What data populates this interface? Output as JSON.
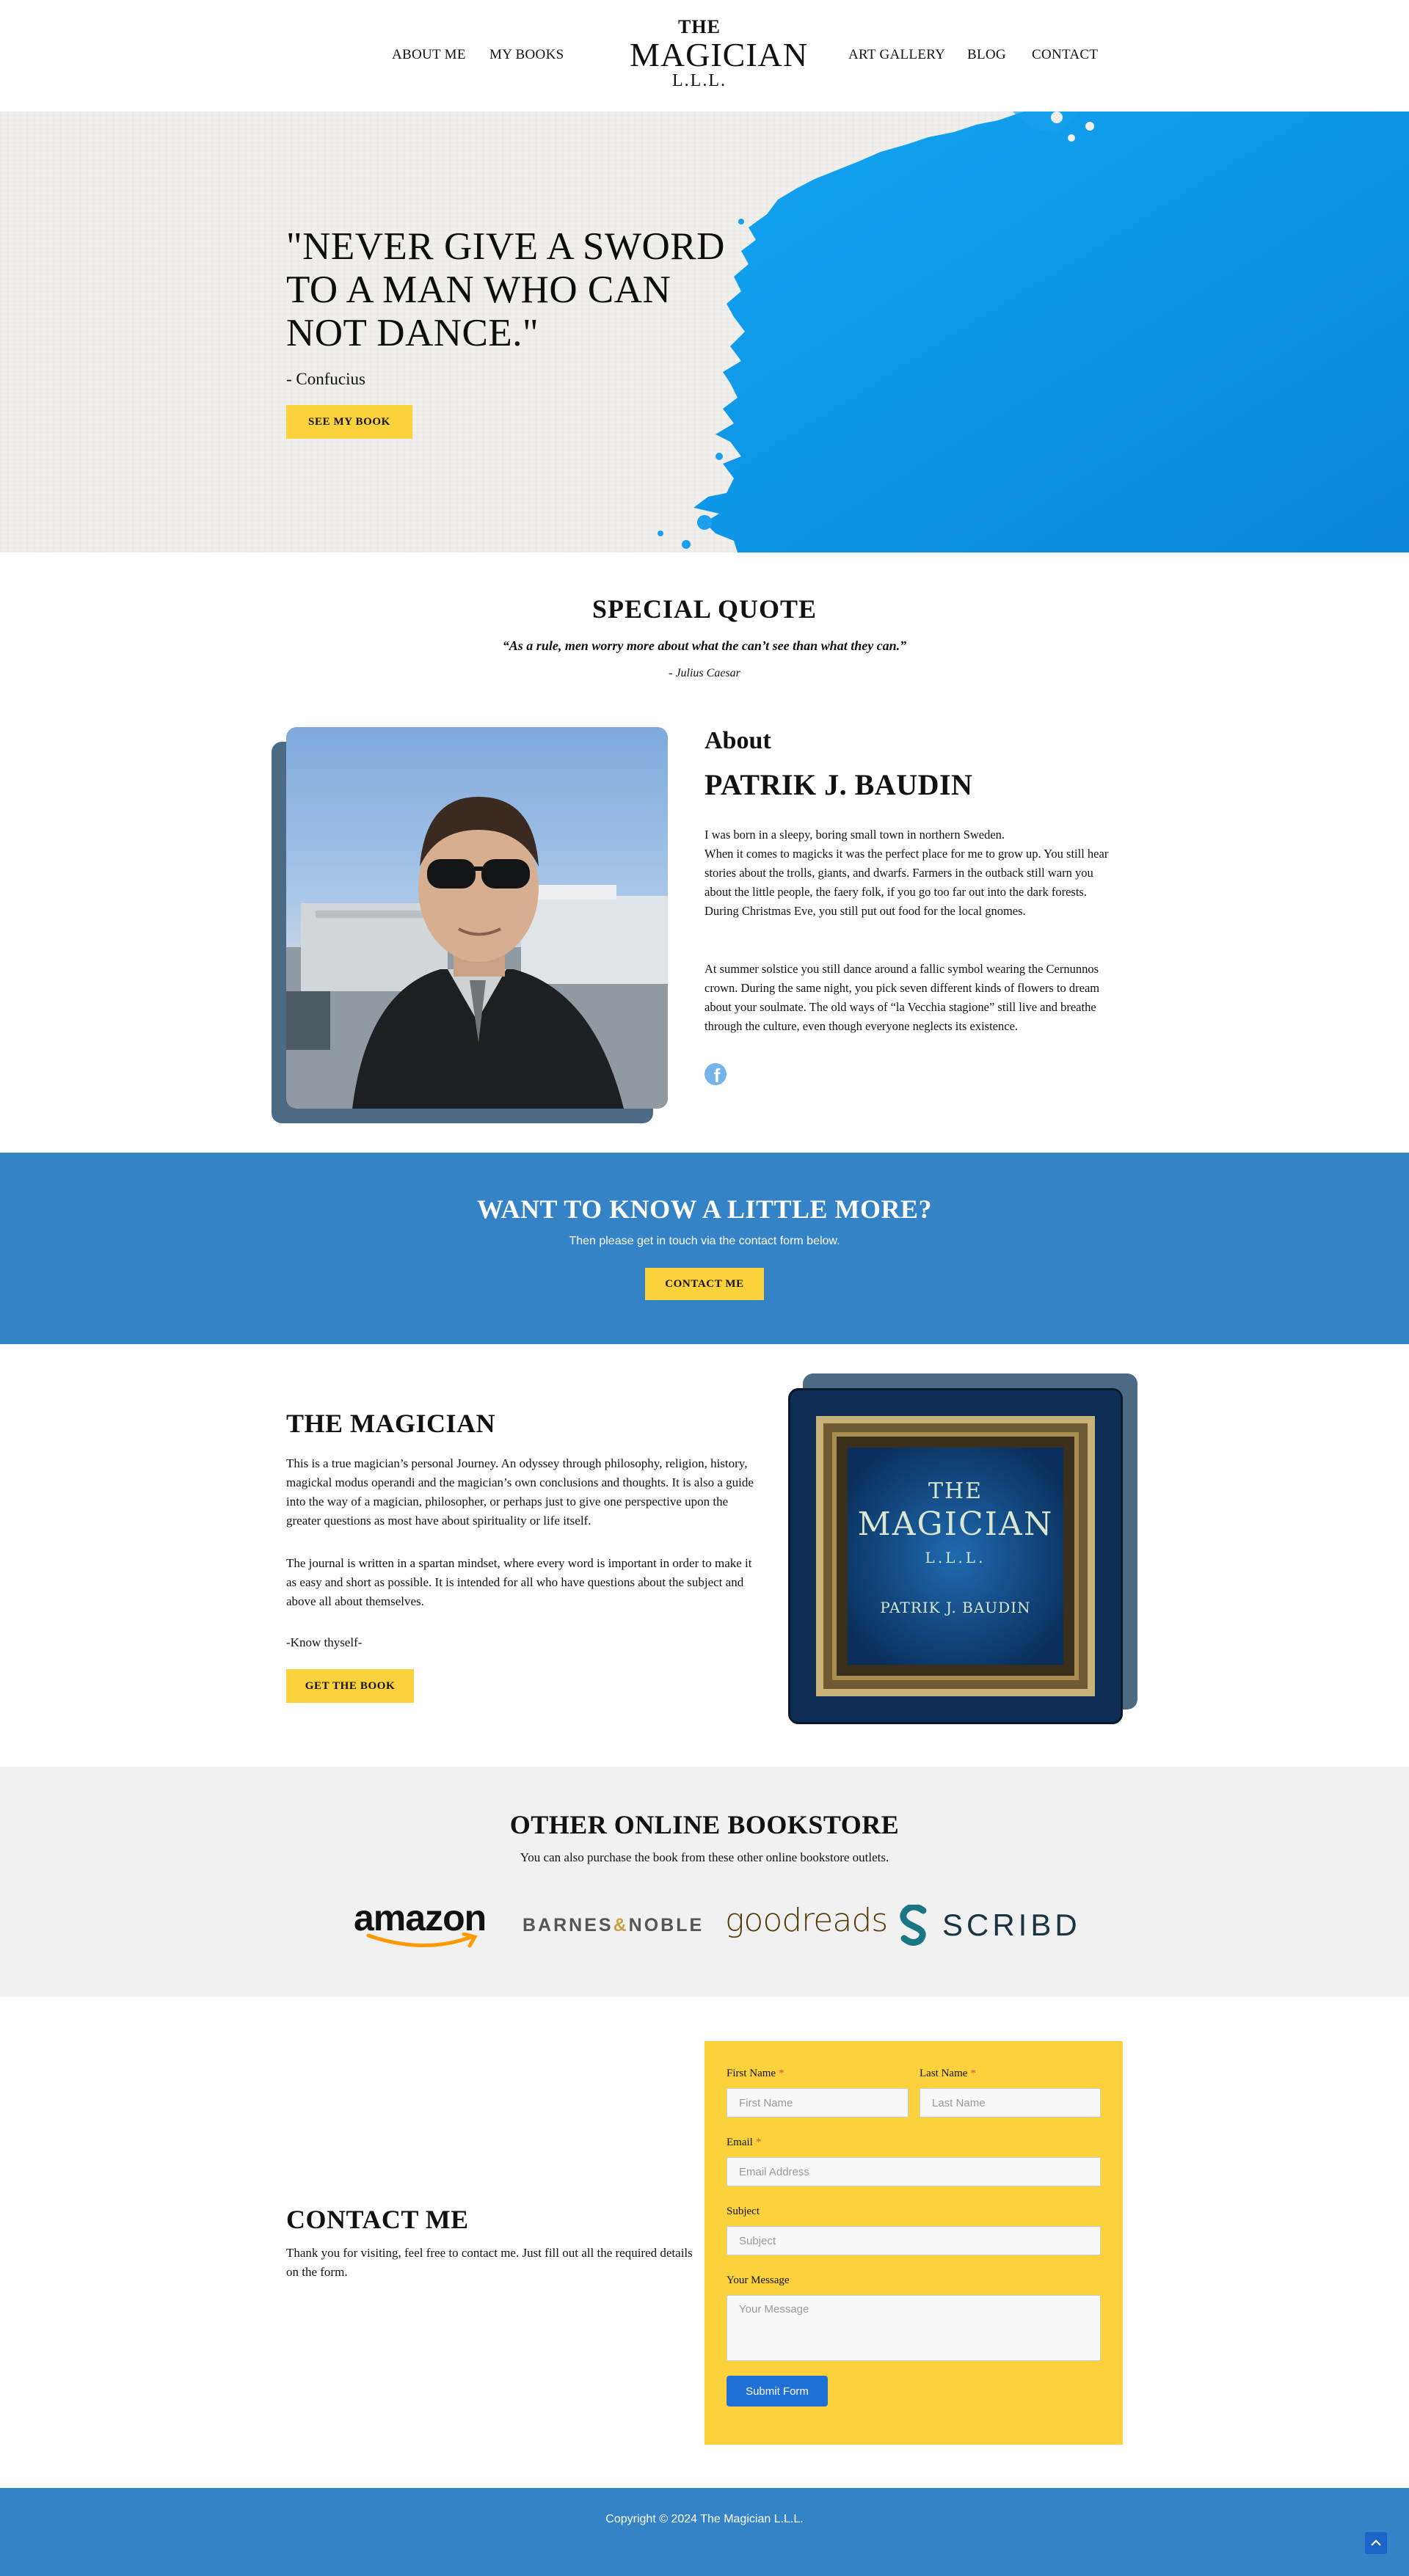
{
  "header": {
    "nav_left": [
      "ABOUT ME",
      "MY BOOKS"
    ],
    "nav_right": [
      "ART GALLERY",
      "BLOG",
      "CONTACT"
    ],
    "logo": {
      "line1": "THE",
      "line2": "MAGICIAN",
      "line3": "L.L.L."
    }
  },
  "hero": {
    "quote": "\"NEVER GIVE A SWORD TO A MAN WHO CAN NOT DANCE.\"",
    "author": "- Confucius",
    "button": "SEE MY BOOK"
  },
  "special_quote": {
    "title": "SPECIAL QUOTE",
    "quote": "“As a rule, men worry more about what the can’t see than what they can.”",
    "author": "- Julius Caesar"
  },
  "about": {
    "label": "About",
    "name": "PATRIK J. BAUDIN",
    "paragraph1": "I was born in a sleepy, boring small town in northern Sweden.\nWhen it comes to magicks it was the perfect place for me to grow up. You still hear stories about the trolls, giants, and dwarfs. Farmers in the outback still warn you about the little people, the faery folk, if you go too far out into the dark forests. During Christmas Eve, you still put out food for the local gnomes.",
    "paragraph2": "At summer solstice you still dance around a fallic symbol wearing the Cernunnos crown. During the same night, you pick seven different kinds of flowers to dream about your soulmate. The old ways of “la Vecchia stagione” still live and breathe through the culture, even though everyone neglects its existence.",
    "social_icon": "facebook-icon"
  },
  "cta": {
    "title": "WANT TO KNOW A LITTLE MORE?",
    "subtitle": "Then please get in touch via the contact form below.",
    "button": "CONTACT ME"
  },
  "book": {
    "title": "THE MAGICIAN",
    "paragraph1": "This is a true magician’s personal Journey. An odyssey through philosophy, religion, history, magickal modus operandi and the magician’s own conclusions and thoughts. It is also a guide into the way of a magician, philosopher, or perhaps just to give one perspective upon the greater questions as most have about spirituality or life itself.",
    "paragraph2": "The journal is written in a spartan mindset, where every word is important in order to make it as easy and short as possible. It is intended for all who have questions about the subject and above all about themselves.",
    "paragraph3": "-Know thyself-",
    "button": "GET THE BOOK",
    "cover": {
      "line1": "THE",
      "line2": "MAGICIAN",
      "line3": "L.L.L.",
      "author": "PATRIK J. BAUDIN"
    }
  },
  "stores": {
    "title": "OTHER ONLINE BOOKSTORE",
    "subtitle": "You can also purchase the book from these other online bookstore outlets.",
    "logos": {
      "amazon": "amazon",
      "bn_a": "BARNES",
      "bn_amp": "&",
      "bn_b": "NOBLE",
      "goodreads": "goodreads",
      "scribd": "SCRIBD"
    }
  },
  "contact": {
    "title": "CONTACT ME",
    "text": "Thank you for visiting, feel free to contact me. Just fill out all the required details on the form.",
    "form": {
      "first_name_label": "First Name",
      "first_name_placeholder": "First Name",
      "last_name_label": "Last Name",
      "last_name_placeholder": "Last Name",
      "email_label": "Email",
      "email_placeholder": "Email Address",
      "subject_label": "Subject",
      "subject_placeholder": "Subject",
      "message_label": "Your Message",
      "message_placeholder": "Your Message",
      "required_mark": "*",
      "submit": "Submit Form"
    }
  },
  "footer": {
    "copyright": "Copyright © 2024 The Magician L.L.L."
  },
  "colors": {
    "brand_blue": "#3383c6",
    "accent_yellow": "#fcd23c",
    "hero_paint_blue": "#1aa0ee",
    "frame_shadow": "#4d6a84",
    "submit_blue": "#1e6fd6"
  }
}
